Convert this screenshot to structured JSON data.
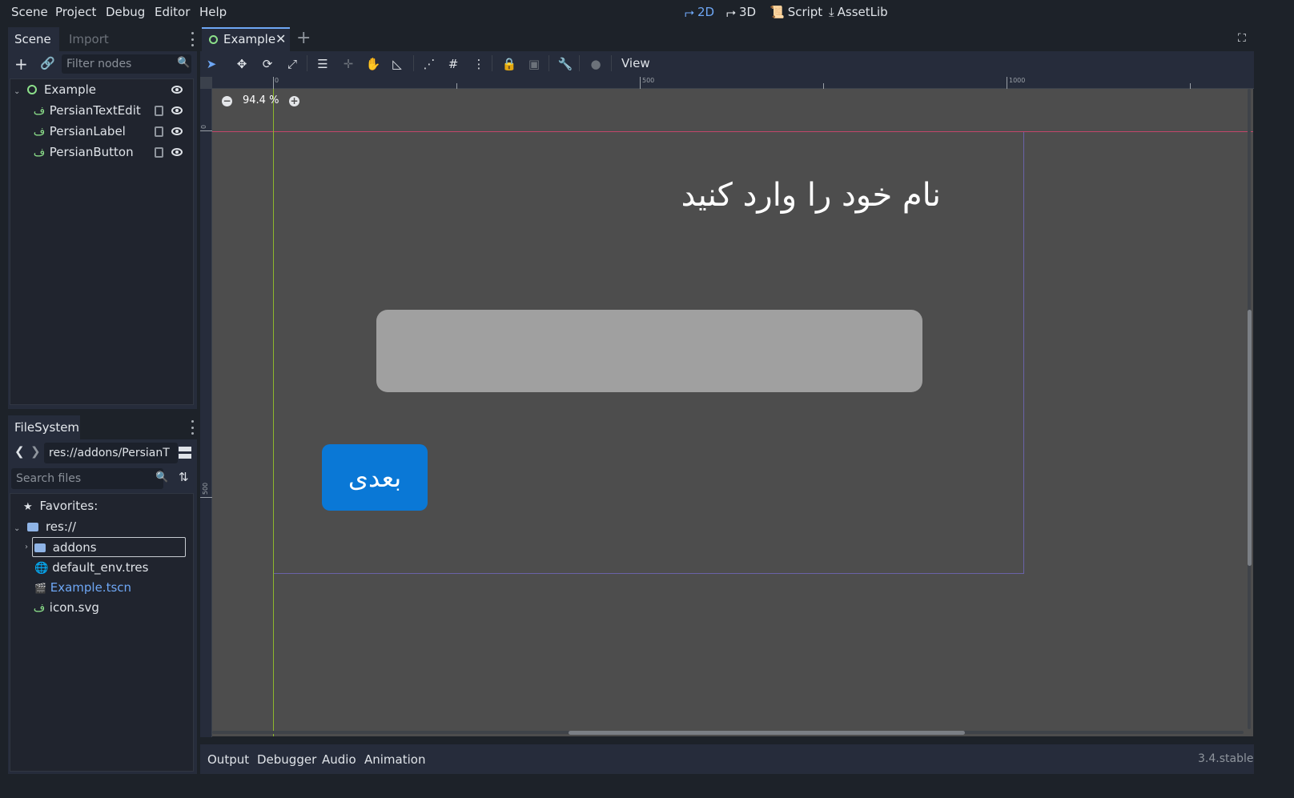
{
  "menu": {
    "scene": "Scene",
    "project": "Project",
    "debug": "Debug",
    "editor": "Editor",
    "help": "Help"
  },
  "workspaces": {
    "two_d": "2D",
    "three_d": "3D",
    "script": "Script",
    "assetlib": "AssetLib"
  },
  "scene_dock": {
    "tab_scene": "Scene",
    "tab_import": "Import",
    "filter_placeholder": "Filter nodes",
    "nodes": [
      {
        "name": "Example",
        "icon": "control-circle-icon"
      },
      {
        "name": "PersianTextEdit",
        "icon": "persian-fa-icon"
      },
      {
        "name": "PersianLabel",
        "icon": "persian-fa-icon"
      },
      {
        "name": "PersianButton",
        "icon": "persian-fa-icon"
      }
    ]
  },
  "filesystem": {
    "title": "FileSystem",
    "path": "res://addons/PersianT",
    "search_placeholder": "Search files",
    "favorites": "Favorites:",
    "root": "res://",
    "items": [
      {
        "name": "addons",
        "icon": "folder-icon"
      },
      {
        "name": "default_env.tres",
        "icon": "globe-icon"
      },
      {
        "name": "Example.tscn",
        "icon": "clapper-icon"
      },
      {
        "name": "icon.svg",
        "icon": "persian-fa-icon"
      }
    ]
  },
  "editor_tabs": {
    "active": "Example"
  },
  "toolbar": {
    "view": "View"
  },
  "canvas": {
    "zoom": "94.4 %",
    "ruler_h": [
      "0",
      "500",
      "1000"
    ],
    "ruler_v": [
      "0",
      "500"
    ],
    "label_text": "نام خود را وارد کنید",
    "button_text": "بعدی",
    "button_color": "#0a78d6",
    "textedit_color": "#a0a0a0"
  },
  "bottom": {
    "output": "Output",
    "debugger": "Debugger",
    "audio": "Audio",
    "animation": "Animation",
    "version": "3.4.stable"
  },
  "colors": {
    "accent": "#6ea7f5",
    "bg": "#1d2229",
    "panel": "#262c3b",
    "viewport": "#4d4d4d"
  }
}
